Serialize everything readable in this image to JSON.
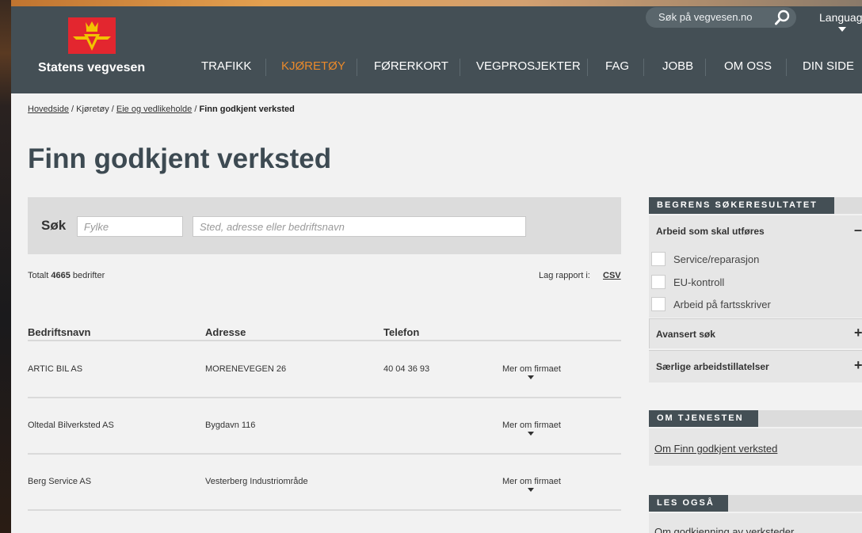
{
  "header": {
    "logo_text": "Statens vegvesen",
    "search_placeholder": "Søk på vegvesen.no",
    "language_label": "Language",
    "nav": [
      {
        "label": "TRAFIKK",
        "active": false
      },
      {
        "label": "KJØRETØY",
        "active": true
      },
      {
        "label": "FØRERKORT",
        "active": false
      },
      {
        "label": "VEGPROSJEKTER",
        "active": false
      },
      {
        "label": "FAG",
        "active": false
      },
      {
        "label": "JOBB",
        "active": false
      },
      {
        "label": "OM OSS",
        "active": false
      },
      {
        "label": "DIN SIDE",
        "active": false
      }
    ]
  },
  "breadcrumb": {
    "home": "Hovedside",
    "sep1": " / ",
    "level1": "Kjøretøy",
    "sep2": " / ",
    "level2": "Eie og vedlikeholde",
    "sep3": " / ",
    "current": "Finn godkjent verksted"
  },
  "page_title": "Finn godkjent verksted",
  "search": {
    "label": "Søk",
    "fylke_placeholder": "Fylke",
    "sted_placeholder": "Sted, adresse eller bedriftsnavn"
  },
  "results": {
    "total_prefix": "Totalt ",
    "total_count": "4665",
    "total_suffix": " bedrifter",
    "report_label": "Lag rapport i:",
    "csv_label": "CSV"
  },
  "table": {
    "headers": [
      "Bedriftsnavn",
      "Adresse",
      "Telefon"
    ],
    "more_label": "Mer om firmaet",
    "rows": [
      {
        "name": "ARTIC BIL AS",
        "address": "MORENEVEGEN 26",
        "phone": "40 04 36 93"
      },
      {
        "name": "Oltedal Bilverksted AS",
        "address": "Bygdavn 116",
        "phone": ""
      },
      {
        "name": "Berg Service AS",
        "address": "Vesterberg Industriområde",
        "phone": ""
      }
    ]
  },
  "sidebar": {
    "filter_heading": "BEGRENS SØKERESULTATET",
    "work_section": {
      "title": "Arbeid som skal utføres",
      "toggle": "–",
      "options": [
        "Service/reparasjon",
        "EU-kontroll",
        "Arbeid på fartsskriver"
      ]
    },
    "advanced": {
      "title": "Avansert søk",
      "toggle": "+"
    },
    "special": {
      "title": "Særlige arbeidstillatelser",
      "toggle": "+"
    },
    "about_heading": "OM TJENESTEN",
    "about_link": "Om Finn godkjent verksted",
    "also_heading": "LES OGSÅ",
    "also_link": "Om godkjenning av verksteder"
  },
  "colors": {
    "header_bg": "#444f55",
    "accent_orange": "#e9892b",
    "logo_red": "#e3262f",
    "logo_gold": "#f2c200",
    "content_bg": "#f2f2f2"
  }
}
